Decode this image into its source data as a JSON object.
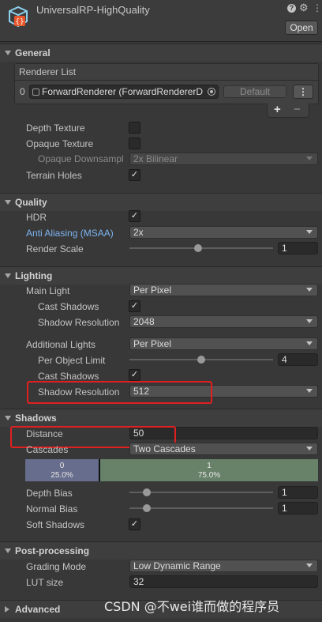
{
  "header": {
    "title": "UniversalRP-HighQuality",
    "open_label": "Open",
    "icons": [
      "asset-icon",
      "help-icon",
      "settings-icon",
      "more-icon"
    ]
  },
  "general": {
    "title": "General",
    "renderer_list_label": "Renderer List",
    "renderer_index": "0",
    "renderer_value": "ForwardRenderer (ForwardRendererD",
    "default_label": "Default",
    "add_label": "+",
    "remove_label": "−",
    "depth_texture": {
      "label": "Depth Texture",
      "checked": false
    },
    "opaque_texture": {
      "label": "Opaque Texture",
      "checked": false
    },
    "opaque_downsampling": {
      "label": "Opaque Downsampl",
      "value": "2x Bilinear"
    },
    "terrain_holes": {
      "label": "Terrain Holes",
      "checked": true
    }
  },
  "quality": {
    "title": "Quality",
    "hdr": {
      "label": "HDR",
      "checked": true
    },
    "anti_aliasing": {
      "label": "Anti Aliasing (MSAA)",
      "value": "2x"
    },
    "render_scale": {
      "label": "Render Scale",
      "value": "1",
      "fraction": 0.48
    }
  },
  "lighting": {
    "title": "Lighting",
    "main_light": {
      "label": "Main Light",
      "value": "Per Pixel"
    },
    "main_cast_shadows": {
      "label": "Cast Shadows",
      "checked": true
    },
    "main_shadow_resolution": {
      "label": "Shadow Resolution",
      "value": "2048"
    },
    "additional_lights": {
      "label": "Additional Lights",
      "value": "Per Pixel"
    },
    "per_object_limit": {
      "label": "Per Object Limit",
      "value": "4",
      "fraction": 0.5
    },
    "additional_cast_shadows": {
      "label": "Cast Shadows",
      "checked": true
    },
    "additional_shadow_resolution": {
      "label": "Shadow Resolution",
      "value": "512"
    }
  },
  "shadows": {
    "title": "Shadows",
    "distance": {
      "label": "Distance",
      "value": "50"
    },
    "cascades": {
      "label": "Cascades",
      "value": "Two Cascades"
    },
    "cascade_split": [
      {
        "index": "0",
        "percent": "25.0%",
        "fraction": 0.25,
        "color": "#676d8c"
      },
      {
        "index": "1",
        "percent": "75.0%",
        "fraction": 0.75,
        "color": "#68826a"
      }
    ],
    "depth_bias": {
      "label": "Depth Bias",
      "value": "1",
      "fraction": 0.12
    },
    "normal_bias": {
      "label": "Normal Bias",
      "value": "1",
      "fraction": 0.12
    },
    "soft_shadows": {
      "label": "Soft Shadows",
      "checked": true
    }
  },
  "post_processing": {
    "title": "Post-processing",
    "grading_mode": {
      "label": "Grading Mode",
      "value": "Low Dynamic Range"
    },
    "lut_size": {
      "label": "LUT size",
      "value": "32"
    }
  },
  "advanced": {
    "title": "Advanced"
  },
  "watermark": "CSDN @不wei谁而做的程序员",
  "colors": {
    "highlight_box": "#e02020",
    "link_label": "#7eb4f0"
  }
}
